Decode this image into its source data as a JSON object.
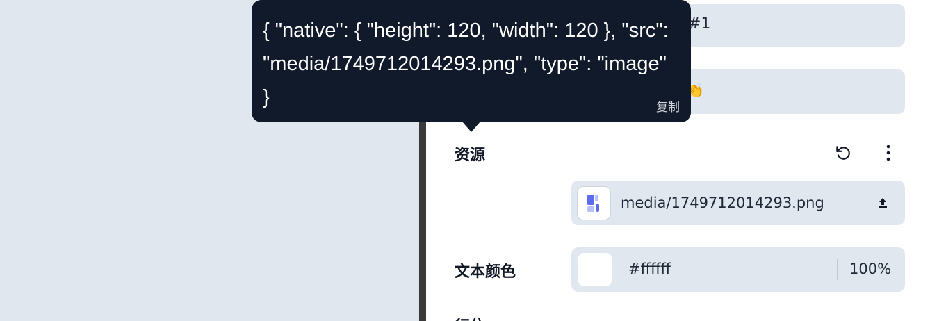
{
  "panel": {
    "top_field_1_text": "#1",
    "top_field_2_text": "👏",
    "resources": {
      "label": "资源",
      "reset_icon": "reset-icon",
      "more_icon": "more-vertical-icon",
      "asset_name": "media/1749712014293.png",
      "upload_icon": "upload-icon"
    },
    "text_color": {
      "label": "文本颜色",
      "hex": "#ffffff",
      "opacity": "100%",
      "swatch_color": "#ffffff"
    },
    "partial_label": "行位"
  },
  "tooltip": {
    "text": "{ \"native\": { \"height\": 120, \"width\": 120 }, \"src\": \"media/1749712014293.png\", \"type\": \"image\" }",
    "copy_label": "复制"
  },
  "colors": {
    "panel_bg": "#ffffff",
    "field_bg": "#e1e7ef",
    "canvas_bg": "#e1e7ef",
    "tooltip_bg": "#111a2b",
    "accent": "#5b6cf0"
  }
}
